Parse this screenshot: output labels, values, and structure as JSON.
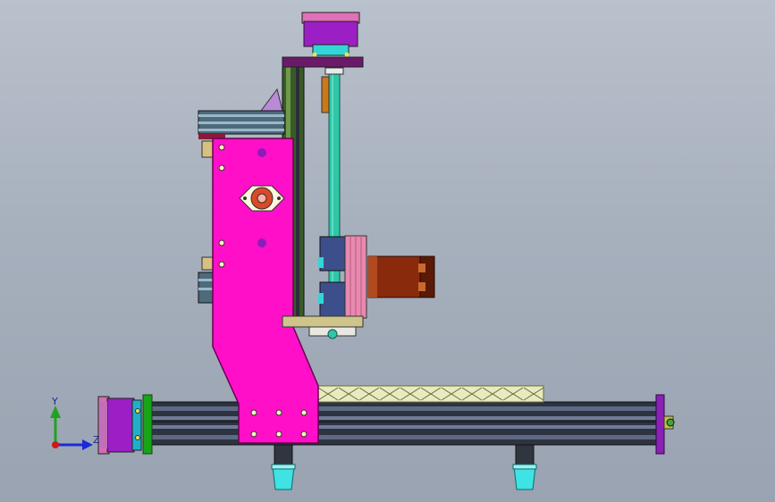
{
  "viewport": {
    "background_top": "#b9c1cc",
    "background_bottom": "#99a3b1"
  },
  "triad": {
    "y_label": "Y",
    "z_label": "Z",
    "y_color": "#1fa31f",
    "z_color": "#1a2ad8",
    "origin_color": "#d01818"
  },
  "colors": {
    "carriage_plate": "#ff10c8",
    "motor": "#9b1fc4",
    "motor_cap": "#e071b8",
    "coupling": "#33d6d6",
    "rail_dark": "#2d3340",
    "rail_mid": "#4d5870",
    "lead_screw": "#2fc7a8",
    "spindle_body": "#8a2a0d",
    "end_plate_green": "#19a319",
    "end_plate_purple": "#8a20b8",
    "base_plate": "#cfc48a",
    "cable_chain": "#e6e8bd",
    "foot": "#3fe3e3",
    "top_plate": "#6b1a6a"
  }
}
